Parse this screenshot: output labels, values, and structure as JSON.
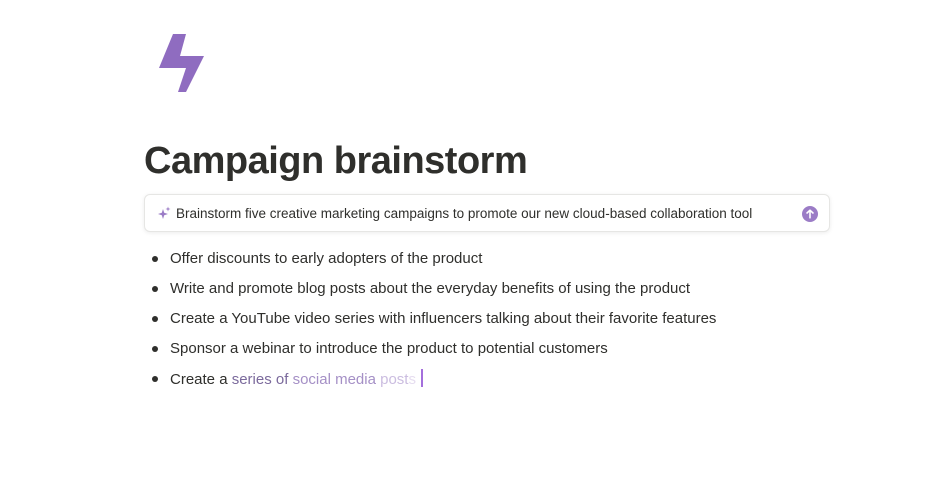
{
  "page": {
    "icon": "lightning-bolt-icon",
    "title": "Campaign brainstorm"
  },
  "ai_prompt": {
    "icon": "sparkle-icon",
    "text": "Brainstorm five creative marketing campaigns to promote our new cloud-based collaboration tool",
    "submit_icon": "arrow-up-icon"
  },
  "bullets": [
    "Offer discounts to early adopters of the product",
    "Write and promote blog posts about the everyday benefits of using the product",
    "Create a YouTube video series with influencers talking about their favorite features",
    "Sponsor a webinar to introduce the product to potential customers"
  ],
  "generating_bullet": {
    "parts": [
      "Create a ",
      "series of ",
      "social media ",
      "post",
      "s"
    ]
  },
  "colors": {
    "accent": "#9b7cc6",
    "caret": "#a46fdc",
    "text": "#2f2f2c"
  }
}
